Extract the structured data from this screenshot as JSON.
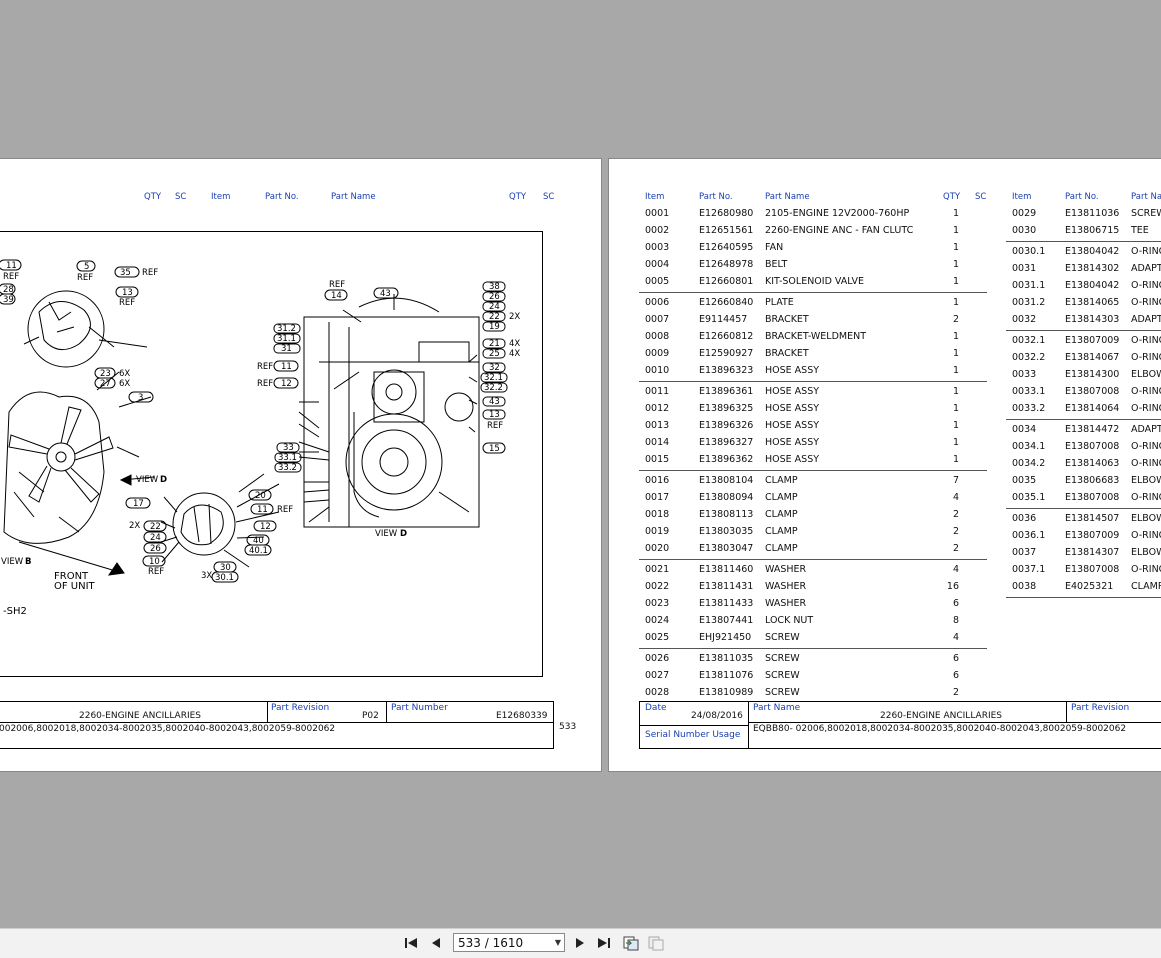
{
  "left_page": {
    "headers": [
      "QTY",
      "SC",
      "Item",
      "Part No.",
      "Part Name",
      "QTY",
      "SC"
    ],
    "drawing": {
      "callouts_left": [
        "11",
        "REF",
        "5",
        "REF",
        "35",
        "REF",
        "28",
        "39",
        "13",
        "REF",
        "23",
        "6X",
        "27",
        "6X",
        "3",
        "17",
        "20",
        "11",
        "REF",
        "2X",
        "22",
        "24",
        "26",
        "12",
        "40",
        "40.1",
        "10",
        "REF",
        "3X",
        "30",
        "30.1",
        "VIEW",
        "B"
      ],
      "view_label_d": "VIEW",
      "view_letter_d": "D",
      "front_line1": "FRONT",
      "front_line2": "OF UNIT",
      "sheet_label": "-SH2",
      "callouts_right": [
        "REF",
        "14",
        "43",
        "38",
        "26",
        "24",
        "22",
        "2X",
        "19",
        "31.2",
        "31.1",
        "31",
        "21",
        "4X",
        "25",
        "4X",
        "32",
        "32.1",
        "32.2",
        "43",
        "13",
        "REF",
        "REF",
        "11",
        "REF",
        "12",
        "33",
        "33.1",
        "33.2",
        "15",
        "VIEW",
        "D"
      ]
    },
    "title_block": {
      "part_name_value": "2260-ENGINE ANCILLARIES",
      "part_revision_label": "Part Revision",
      "part_revision_value": "P02",
      "part_number_label": "Part Number",
      "part_number_value": "E12680339",
      "serial_value": "002006,8002018,8002034-8002035,8002040-8002043,8002059-8002062"
    },
    "page_number": "533"
  },
  "right_page": {
    "headers": {
      "item": "Item",
      "part_no": "Part No.",
      "part_name": "Part Name",
      "qty": "QTY",
      "sc": "SC",
      "item2": "Item",
      "part_no2": "Part No.",
      "part_name2": "Part Nam"
    },
    "groups_col1": [
      [
        [
          "0001",
          "E12680980",
          "2105-ENGINE 12V2000-760HP",
          "1"
        ],
        [
          "0002",
          "E12651561",
          "2260-ENGINE ANC - FAN CLUTC",
          "1"
        ],
        [
          "0003",
          "E12640595",
          "FAN",
          "1"
        ],
        [
          "0004",
          "E12648978",
          "BELT",
          "1"
        ],
        [
          "0005",
          "E12660801",
          "KIT-SOLENOID VALVE",
          "1"
        ]
      ],
      [
        [
          "0006",
          "E12660840",
          "PLATE",
          "1"
        ],
        [
          "0007",
          "E9114457",
          "BRACKET",
          "2"
        ],
        [
          "0008",
          "E12660812",
          "BRACKET-WELDMENT",
          "1"
        ],
        [
          "0009",
          "E12590927",
          "BRACKET",
          "1"
        ],
        [
          "0010",
          "E13896323",
          "HOSE ASSY",
          "1"
        ]
      ],
      [
        [
          "0011",
          "E13896361",
          "HOSE ASSY",
          "1"
        ],
        [
          "0012",
          "E13896325",
          "HOSE ASSY",
          "1"
        ],
        [
          "0013",
          "E13896326",
          "HOSE ASSY",
          "1"
        ],
        [
          "0014",
          "E13896327",
          "HOSE ASSY",
          "1"
        ],
        [
          "0015",
          "E13896362",
          "HOSE ASSY",
          "1"
        ]
      ],
      [
        [
          "0016",
          "E13808104",
          "CLAMP",
          "7"
        ],
        [
          "0017",
          "E13808094",
          "CLAMP",
          "4"
        ],
        [
          "0018",
          "E13808113",
          "CLAMP",
          "2"
        ],
        [
          "0019",
          "E13803035",
          "CLAMP",
          "2"
        ],
        [
          "0020",
          "E13803047",
          "CLAMP",
          "2"
        ]
      ],
      [
        [
          "0021",
          "E13811460",
          "WASHER",
          "4"
        ],
        [
          "0022",
          "E13811431",
          "WASHER",
          "16"
        ],
        [
          "0023",
          "E13811433",
          "WASHER",
          "6"
        ],
        [
          "0024",
          "E13807441",
          "LOCK NUT",
          "8"
        ],
        [
          "0025",
          "EHJ921450",
          "SCREW",
          "4"
        ]
      ],
      [
        [
          "0026",
          "E13811035",
          "SCREW",
          "6"
        ],
        [
          "0027",
          "E13811076",
          "SCREW",
          "6"
        ],
        [
          "0028",
          "E13810989",
          "SCREW",
          "2"
        ]
      ]
    ],
    "groups_col2": [
      [
        [
          "0029",
          "E13811036",
          "SCREW"
        ],
        [
          "0030",
          "E13806715",
          "TEE"
        ]
      ],
      [
        [
          "0030.1",
          "E13804042",
          "O-RING"
        ],
        [
          "0031",
          "E13814302",
          "ADAPT"
        ],
        [
          "0031.1",
          "E13804042",
          "O-RING"
        ],
        [
          "0031.2",
          "E13814065",
          "O-RING"
        ],
        [
          "0032",
          "E13814303",
          "ADAPT"
        ]
      ],
      [
        [
          "0032.1",
          "E13807009",
          "O-RING"
        ],
        [
          "0032.2",
          "E13814067",
          "O-RING"
        ],
        [
          "0033",
          "E13814300",
          "ELBOW"
        ],
        [
          "0033.1",
          "E13807008",
          "O-RING"
        ],
        [
          "0033.2",
          "E13814064",
          "O-RING"
        ]
      ],
      [
        [
          "0034",
          "E13814472",
          "ADAPT"
        ],
        [
          "0034.1",
          "E13807008",
          "O-RING"
        ],
        [
          "0034.2",
          "E13814063",
          "O-RING"
        ],
        [
          "0035",
          "E13806683",
          "ELBOW"
        ],
        [
          "0035.1",
          "E13807008",
          "O-RING"
        ]
      ],
      [
        [
          "0036",
          "E13814507",
          "ELBOW"
        ],
        [
          "0036.1",
          "E13807009",
          "O-RING"
        ],
        [
          "0037",
          "E13814307",
          "ELBOW"
        ],
        [
          "0037.1",
          "E13807008",
          "O-RING"
        ],
        [
          "0038",
          "E4025321",
          "CLAMP"
        ]
      ]
    ],
    "title_block": {
      "date_label": "Date",
      "date_value": "24/08/2016",
      "part_name_label": "Part Name",
      "part_name_value": "2260-ENGINE ANCILLARIES",
      "part_revision_label": "Part Revision",
      "serial_label": "Serial Number Usage",
      "serial_value": "EQBB80-  02006,8002018,8002034-8002035,8002040-8002043,8002059-8002062"
    }
  },
  "toolbar": {
    "page_indicator": "533 / 1610"
  }
}
